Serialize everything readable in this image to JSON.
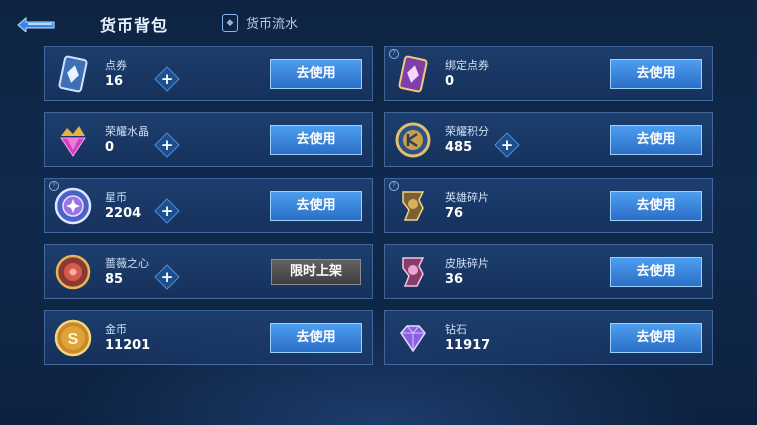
{
  "header": {
    "title": "货币背包",
    "flow_label": "货币流水"
  },
  "colors": {
    "accent_blue": "#2b6fc6",
    "button_border": "#9bd0ff",
    "disabled_gray": "#3f3f3f"
  },
  "items": [
    {
      "name": "点券",
      "count": "16",
      "button": "去使用",
      "icon": "coupon-icon",
      "plus": true
    },
    {
      "name": "绑定点券",
      "count": "0",
      "button": "去使用",
      "icon": "bound-coupon-icon",
      "plus": false
    },
    {
      "name": "荣耀水晶",
      "count": "0",
      "button": "去使用",
      "icon": "glory-crystal-icon",
      "plus": true
    },
    {
      "name": "荣耀积分",
      "count": "485",
      "button": "去使用",
      "icon": "glory-points-icon",
      "plus": true
    },
    {
      "name": "星币",
      "count": "2204",
      "button": "去使用",
      "icon": "star-coin-icon",
      "plus": true
    },
    {
      "name": "英雄碎片",
      "count": "76",
      "button": "去使用",
      "icon": "hero-shard-icon",
      "plus": false
    },
    {
      "name": "蔷薇之心",
      "count": "85",
      "button": "限时上架",
      "icon": "rose-heart-icon",
      "plus": true
    },
    {
      "name": "皮肤碎片",
      "count": "36",
      "button": "去使用",
      "icon": "skin-shard-icon",
      "plus": false
    },
    {
      "name": "金币",
      "count": "11201",
      "button": "去使用",
      "icon": "gold-coin-icon",
      "plus": false
    },
    {
      "name": "钻石",
      "count": "11917",
      "button": "去使用",
      "icon": "diamond-icon",
      "plus": false
    }
  ]
}
